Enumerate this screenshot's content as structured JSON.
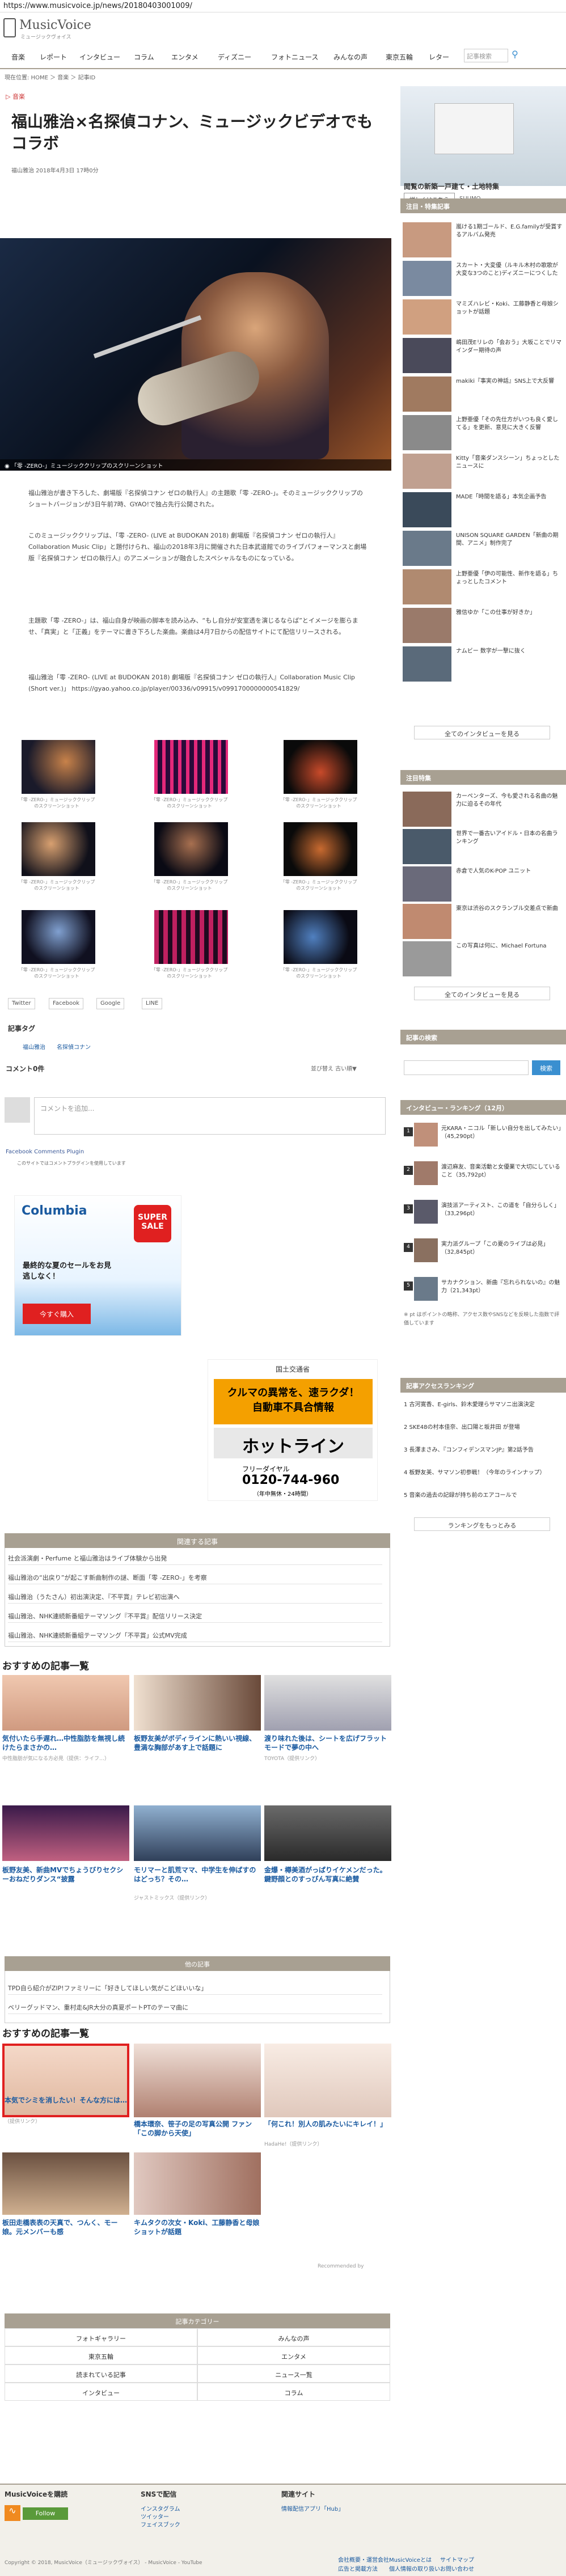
{
  "url": "https://www.musicvoice.jp/news/20180403001009/",
  "logo": {
    "name": "MusicVoice",
    "sub": "ミュージックヴォイス"
  },
  "nav": {
    "items": [
      "音楽",
      "レポート",
      "インタビュー",
      "コラム",
      "エンタメ",
      "ディズニー",
      "フォトニュース",
      "みんなの声",
      "東京五輪",
      "レター"
    ],
    "search_placeholder": "記事検索",
    "search_icon": "search-icon"
  },
  "breadcrumb": "現在位置: HOME ＞ 音楽 ＞ 記事ID",
  "article": {
    "category": "音楽",
    "title": "福山雅治×名探偵コナン、ミュージックビデオでもコラボ",
    "byline": "福山雅治 2018年4月3日 17時0分",
    "hero_caption": "「零 -ZERO-」ミュージッククリップのスクリーンショット",
    "paragraphs": [
      "福山雅治が書き下ろした、劇場版『名探偵コナン ゼロの執行人』の主題歌「零 -ZERO-」。そのミュージッククリップのショートバージョンが3日午前7時、GYAO!で独占先行公開された。",
      "このミュージッククリップは、「零 -ZERO- (LIVE at BUDOKAN 2018) 劇場版『名探偵コナン ゼロの執行人』Collaboration Music Clip」と題付けられ、福山の2018年3月に開催された日本武道館でのライブパフォーマンスと劇場版『名探偵コナン ゼロの執行人』のアニメーションが融合したスペシャルなものになっている。",
      "主題歌「零 -ZERO-」は、福山自身が映画の脚本を読み込み、“もし自分が安室透を演じるならば”とイメージを膨らませ、「真実」と「正義」をテーマに書き下ろした楽曲。楽曲は4月7日からの配信サイトにて配信リリースされる。",
      "福山雅治「零 -ZERO- (LIVE at BUDOKAN 2018) 劇場版『名探偵コナン ゼロの執行人』Collaboration Music Clip (Short ver.)」 https://gyao.yahoo.co.jp/player/00336/v09915/v0991700000000541829/"
    ],
    "grid_caption": "「零 -ZERO-」ミュージッククリップのスクリーンショット",
    "share": [
      "Twitter",
      "Facebook",
      "Google",
      "LINE"
    ],
    "tag_label": "記事タグ",
    "tags": [
      "福山雅治",
      "名探偵コナン"
    ],
    "comments_label": "コメント0件",
    "comments_sort": "並び替え 古い順▼",
    "comment_placeholder": "コメントを追加...",
    "fb_plugin": "Facebook Comments Plugin",
    "fb_note": "このサイトではコメントプラグインを使用しています"
  },
  "ads": {
    "columbia": {
      "brand": "Columbia",
      "badge": "SUPER SALE",
      "line1": "最終的な夏のセールをお見逃しなく！",
      "button": "今すぐ購入"
    },
    "kokuritsu": {
      "brand": "国土交通省",
      "line1": "クルマの異常を、速ラクダ！",
      "line2": "自動車不具合情報",
      "line3": "ホットライン",
      "line4": "フリーダイヤル",
      "phone": "0120-744-960",
      "hours": "（年中無休・24時間）"
    }
  },
  "related": {
    "head": "関連する記事",
    "items": [
      "社会派演劇・Perfume と福山雅治はライブ体験から出発",
      "福山雅治の“出戻り”が起こす新曲制作の謎、断面「零 -ZERO-」を考察",
      "福山雅治（うたさん）初出演決定、『不平賞』テレビ初出演へ",
      "福山雅治、NHK連続新番組テーマソング『不平賞』配信リリース決定",
      "福山雅治、NHK連続新番組テーマソング「不平賞」公式MV完成"
    ]
  },
  "recommended1": {
    "title": "おすすめの記事一覧",
    "items": [
      {
        "text": "気付いたら手遅れ…中性脂肪を無視し続けたらまさかの…",
        "src": "中性脂肪が気になる方必見（提供：ライフ…）"
      },
      {
        "text": "板野友美がボディラインに熱いい視線、豊満な胸部があす上で話題に",
        "src": ""
      },
      {
        "text": "渡り味れた後は、シートを広げフラットモードで夢の中へ",
        "src": "TOYOTA（提供リンク）"
      },
      {
        "text": "板野友美、新曲MVでちょうびりセクシーおねだりダンス“披露",
        "src": ""
      },
      {
        "text": "モリマーと肌荒ママ、中学生を伸ばすのはどっち？その…",
        "src": "ジャストミックス（提供リンク）"
      },
      {
        "text": "金爆・樽美酒がっぱりイケメンだった。鍵野顔とのすっぴん写真に絶賛",
        "src": ""
      }
    ]
  },
  "other": {
    "head": "他の記事",
    "items": [
      "TPD自ら紹介がZIP!ファミリーに「好きしてほしい気がこどほいいな」",
      "ベリーグッドマン、重村走&JR大分の真夏ポートPTのテーマ曲に"
    ]
  },
  "recommended2": {
    "title": "おすすめの記事一覧",
    "items": [
      {
        "text": "本気でシミを消したい！そんな方には…",
        "src": "（提供リンク）"
      },
      {
        "text": "橋本環奈、笹子の足の写真公開 ファン「この脚から天使」",
        "src": ""
      },
      {
        "text": "「何これ！別人の肌みたいにキレイ！」",
        "src": "HadaHe!（提供リンク）"
      },
      {
        "text": "板田走橋表表の天真で、つんく、モー娘。元メンバーも感",
        "src": ""
      },
      {
        "text": "キムタクの次女・Koki、工藤静香と母娘ショットが話題",
        "src": ""
      }
    ],
    "adlabel": "Recommended by"
  },
  "footer_links": {
    "head": "記事カテゴリー",
    "cells": [
      "フォトギャラリー",
      "みんなの声",
      "東京五輪",
      "エンタメ",
      "読まれている記事",
      "ニュース一覧",
      "インタビュー",
      "コラム"
    ]
  },
  "sidebar": {
    "ad_caption": "閲覧の新築一戸建て・土地特集",
    "ad_button": "詳しくはこちら",
    "ad_sub": "SUUMO",
    "pickup_head": "注目・特集記事",
    "pickup": [
      "嵐ける1期ゴールド、E.G.familyが受賞するアルバム発売",
      "スカート・大変優（ルキル木村の歌歌が大変な3つのこと)ディズニーにつくした",
      "マミズハレビ・Koki、工藤静香と母娘ショットが話題",
      "嶋田茂Eリレの「会おう」大坂ことでリマインダー期待の声",
      "makiki『事実の神話』SNS上で大反響",
      "上野亜優「その先仕方がいつも良く愛してる」を更新、意見に大きく反響",
      "Kitty「音楽ダンスシーン」ちょっとしたニュースに",
      "MADE「時間を語る」本気企画予告",
      "UNISON SQUARE GARDEN「新曲の期間、アニメ」制作完了",
      "上野亜優「伊の可能性、新作を語る」ちょっとしたコメント",
      "雅信ゆか「この仕事が好きか」",
      "ナムビー 数字が一撃に抜く"
    ],
    "pickup_more": "全てのインタビューを見る",
    "live_head": "注目特集",
    "live": [
      "カーペンターズ、今も愛される名曲の魅力に迫るその年代",
      "世界で一番古いアイドル・日本の名曲ランキング",
      "赤倉で人気のK-POP ユニット",
      "東京は渋谷のスクランブル交差点で新曲",
      "この写真は何に、Michael Fortuna"
    ],
    "live_more": "全てのインタビューを見る",
    "search_head": "記事の検索",
    "search_button": "検索",
    "rank_head": "インタビュー・ランキング（12月）",
    "rank": [
      "元KARA・ニコル「新しい自分を出してみたい」（45,290pt）",
      "渡辺麻友、音楽活動と女優業で大切にしていること（35,792pt）",
      "演技派アーティスト、この道を「自分らしく」（33,296pt）",
      "実力派グループ「この夏のライブは必見」（32,845pt）",
      "サカナクション、新曲『忘れられないの』の魅力（21,343pt）"
    ],
    "rank_note": "※ pt はポイントの略称、アクセス数やSNSなどを反映した指数で評価しています",
    "acc_head": "記事アクセスランキング",
    "acc": [
      "1 古河寛香、E-girls、鈴木愛理らサマソニ出演決定",
      "2 SKE48の村本佳奈、出口陽と坂井田 が登場",
      "3 長澤まさみ、『コンフィデンスマンJP』第2話予告",
      "4 板野友美、サマソン初参戦！（今年のラインナップ）",
      "5 音楽の過去の記録が持ち前のエアコールで"
    ],
    "acc_more": "ランキングをもっとみる"
  },
  "footer": {
    "col1_head": "MusicVoiceを購読",
    "follow": "Follow",
    "col2_head": "SNSで配信",
    "col2_links": [
      "インスタグラム",
      "ツイッター",
      "フェイスブック"
    ],
    "col3_head": "関連サイト",
    "col3_links": [
      "情報配信アプリ「Hub」"
    ],
    "copyright": "Copyright © 2018, MusicVoice（ミュージックヴォイス） - MusicVoice - YouTube",
    "right_links": [
      "会社概要・運営会社",
      "MusicVoiceとは",
      "サイトマップ",
      "広告と掲載方法",
      "個人情報の取り扱い",
      "お問い合わせ"
    ]
  }
}
